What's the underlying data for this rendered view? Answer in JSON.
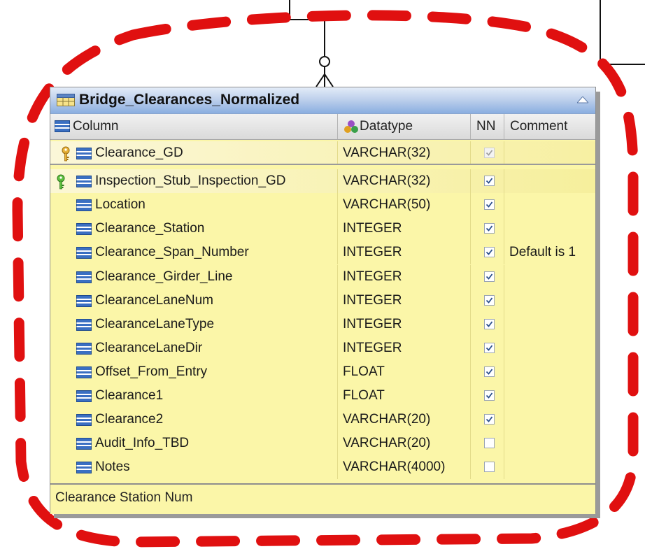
{
  "entity": {
    "title": "Bridge_Clearances_Normalized",
    "headers": {
      "column": "Column",
      "datatype": "Datatype",
      "nn": "NN",
      "comment": "Comment"
    },
    "rows": [
      {
        "name": "Clearance_GD",
        "type": "VARCHAR(32)",
        "nn": true,
        "nn_disabled": true,
        "comment": "",
        "key": "primary"
      },
      {
        "name": "Inspection_Stub_Inspection_GD",
        "type": "VARCHAR(32)",
        "nn": true,
        "nn_disabled": false,
        "comment": "",
        "key": "foreign"
      },
      {
        "name": "Location",
        "type": "VARCHAR(50)",
        "nn": true,
        "nn_disabled": false,
        "comment": "",
        "key": ""
      },
      {
        "name": "Clearance_Station",
        "type": "INTEGER",
        "nn": true,
        "nn_disabled": false,
        "comment": "",
        "key": ""
      },
      {
        "name": "Clearance_Span_Number",
        "type": "INTEGER",
        "nn": true,
        "nn_disabled": false,
        "comment": "Default is 1",
        "key": ""
      },
      {
        "name": "Clearance_Girder_Line",
        "type": "INTEGER",
        "nn": true,
        "nn_disabled": false,
        "comment": "",
        "key": ""
      },
      {
        "name": "ClearanceLaneNum",
        "type": "INTEGER",
        "nn": true,
        "nn_disabled": false,
        "comment": "",
        "key": ""
      },
      {
        "name": "ClearanceLaneType",
        "type": "INTEGER",
        "nn": true,
        "nn_disabled": false,
        "comment": "",
        "key": ""
      },
      {
        "name": "ClearanceLaneDir",
        "type": "INTEGER",
        "nn": true,
        "nn_disabled": false,
        "comment": "",
        "key": ""
      },
      {
        "name": "Offset_From_Entry",
        "type": "FLOAT",
        "nn": true,
        "nn_disabled": false,
        "comment": "",
        "key": ""
      },
      {
        "name": "Clearance1",
        "type": "FLOAT",
        "nn": true,
        "nn_disabled": false,
        "comment": "",
        "key": ""
      },
      {
        "name": "Clearance2",
        "type": "VARCHAR(20)",
        "nn": true,
        "nn_disabled": false,
        "comment": "",
        "key": ""
      },
      {
        "name": "Audit_Info_TBD",
        "type": "VARCHAR(20)",
        "nn": false,
        "nn_disabled": false,
        "comment": "",
        "key": ""
      },
      {
        "name": "Notes",
        "type": "VARCHAR(4000)",
        "nn": false,
        "nn_disabled": false,
        "comment": "",
        "key": ""
      }
    ],
    "status_text": "Clearance Station Num"
  },
  "colors": {
    "entity_fill": "#fbf6a8",
    "title_bar": "#bfd1ec",
    "highlight_dash": "#e01010",
    "connector_line": "#111111"
  },
  "icons": {
    "table": "table-icon",
    "datatype": "datatype-icon",
    "column": "column-icon",
    "primary_key": "primary-key-icon",
    "foreign_key": "foreign-key-icon",
    "collapse": "collapse-arrow-icon"
  }
}
